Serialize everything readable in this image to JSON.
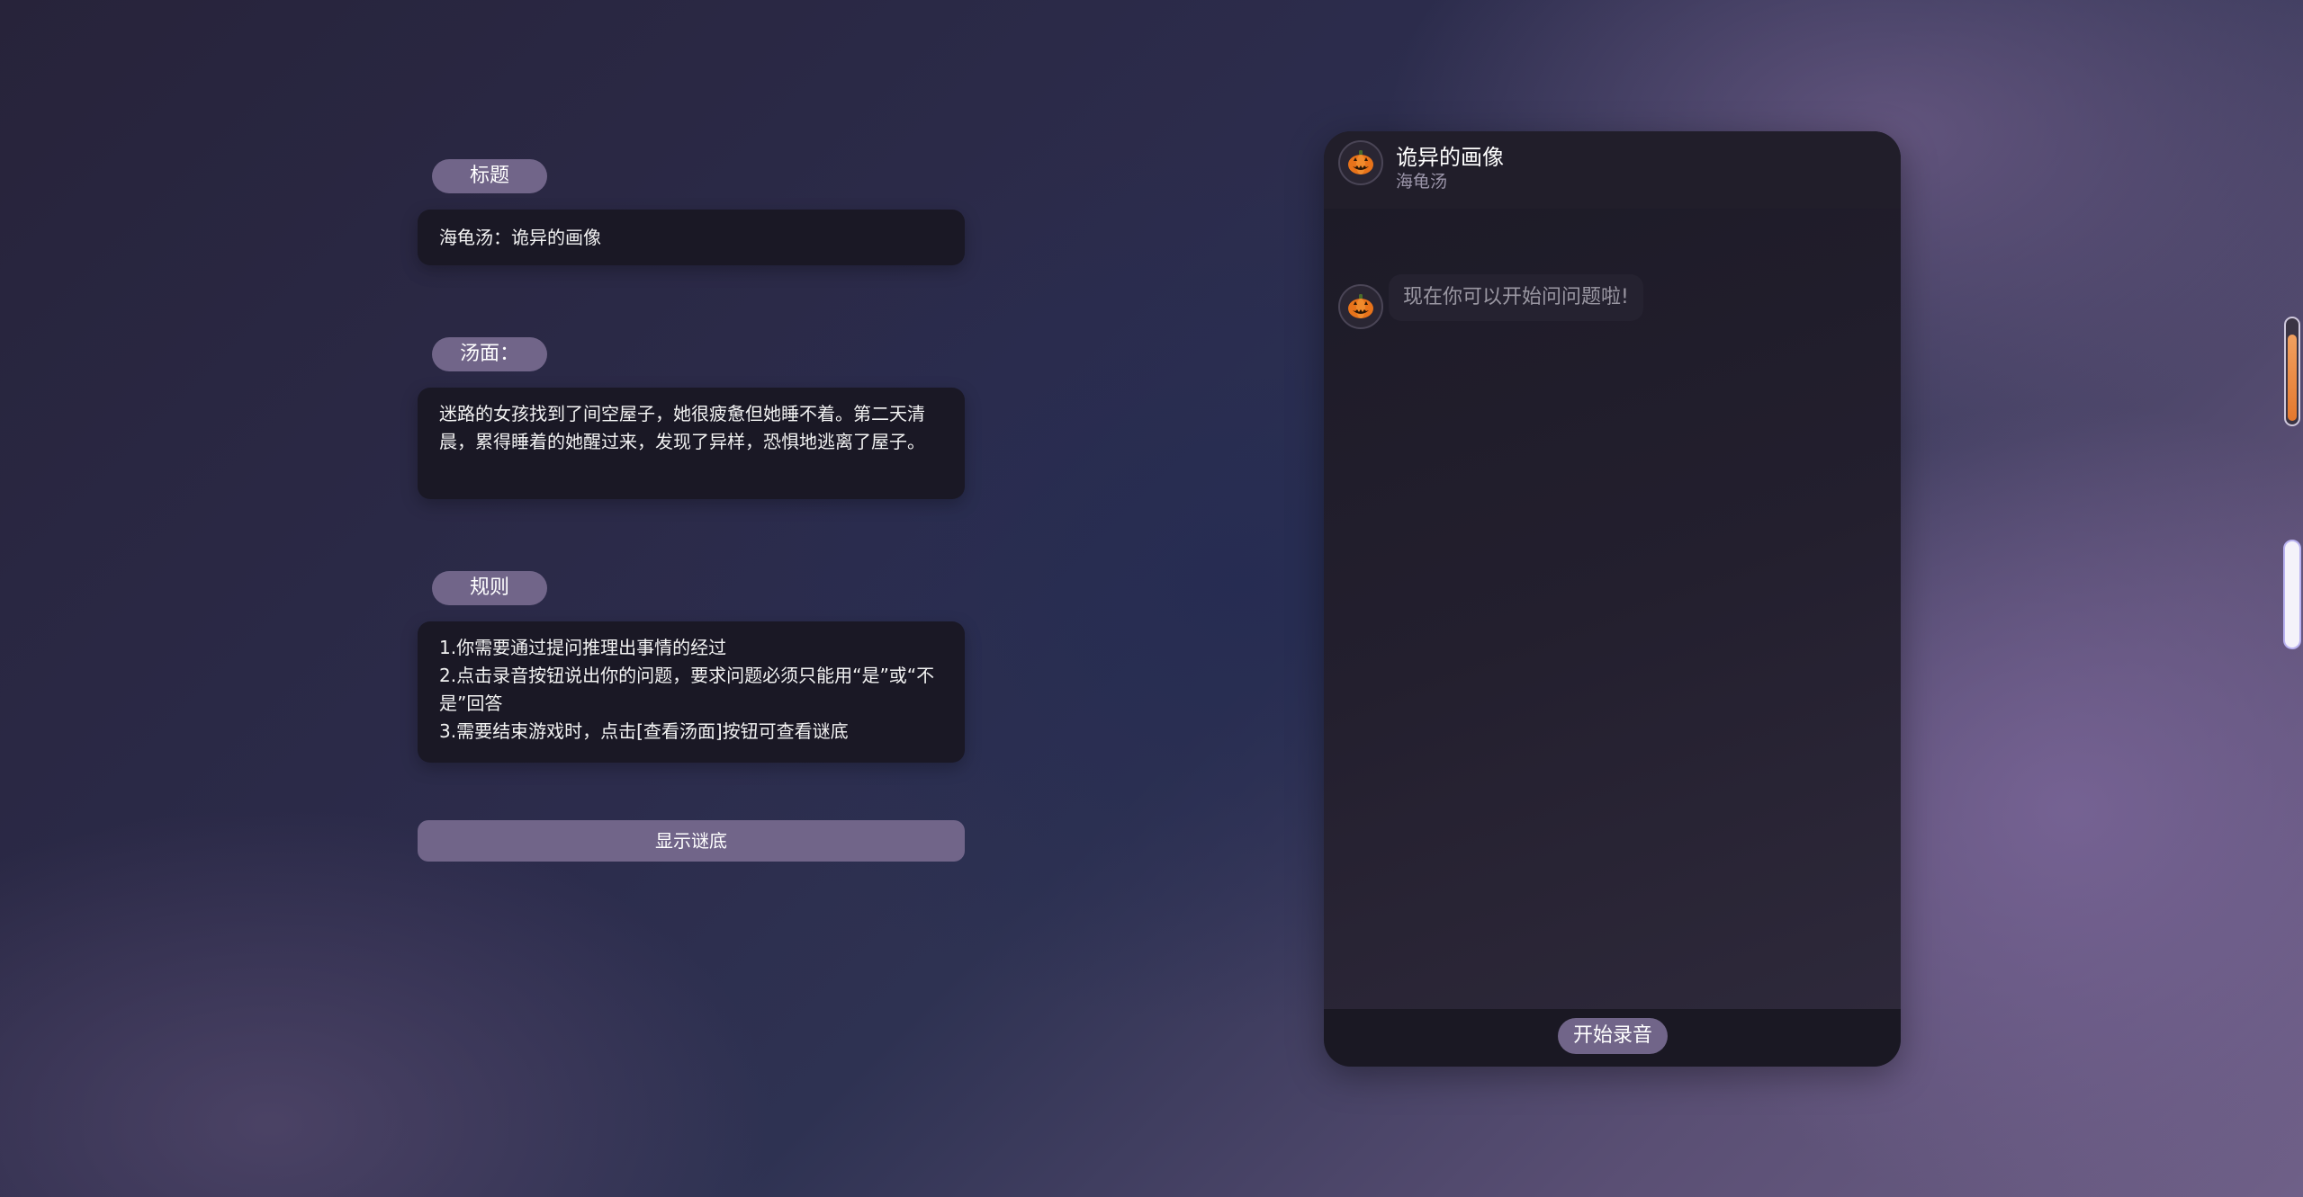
{
  "info": {
    "title_label": "标题",
    "title_value": "海龟汤：诡异的画像",
    "soup_label": "汤面：",
    "soup_text": "迷路的女孩找到了间空屋子，她很疲惫但她睡不着。第二天清晨，累得睡着的她醒过来，发现了异样，恐惧地逃离了屋子。",
    "rules_label": "规则",
    "rules": [
      "1.你需要通过提问推理出事情的经过",
      "2.点击录音按钮说出你的问题，要求问题必须只能用“是”或“不是”回答",
      "3.需要结束游戏时，点击[查看汤面]按钮可查看谜底"
    ],
    "reveal_button": "显示谜底"
  },
  "chat": {
    "title": "诡异的画像",
    "subtitle": "海龟汤",
    "avatar_icon": "pumpkin-icon",
    "messages": [
      {
        "sender": "bot",
        "text": "现在你可以开始问问题啦!"
      }
    ],
    "record_button": "开始录音"
  },
  "colors": {
    "accent": "#716589",
    "panel_dark": "#1a1825",
    "scroll_thumb": "#e4782e"
  }
}
